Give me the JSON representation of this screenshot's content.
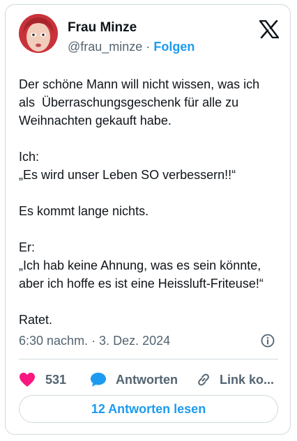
{
  "author": {
    "name": "Frau Minze",
    "handle": "@frau_minze",
    "separator": "·",
    "follow_label": "Folgen",
    "avatar_icon": "profile-photo-red-hair-woman"
  },
  "tweet": {
    "text": "Der schöne Mann will nicht wissen, was ich als  Überraschungsgeschenk für alle zu Weihnachten gekauft habe.\n\nIch:\n„Es wird unser Leben SO verbessern!!“\n\nEs kommt lange nichts.\n\nEr:\n„Ich hab keine Ahnung, was es sein könnte, aber ich hoffe es ist eine Heissluft-Friteuse!“\n\nRatet.",
    "timestamp": "6:30 nachm. · 3. Dez. 2024"
  },
  "actions": {
    "like_count": "531",
    "reply_label": "Antworten",
    "link_label": "Link ko..."
  },
  "footer": {
    "read_replies_label": "12 Antworten lesen"
  },
  "colors": {
    "accent": "#1d9bf0",
    "like": "#f91880",
    "muted": "#536471",
    "border": "#cfd9de"
  }
}
